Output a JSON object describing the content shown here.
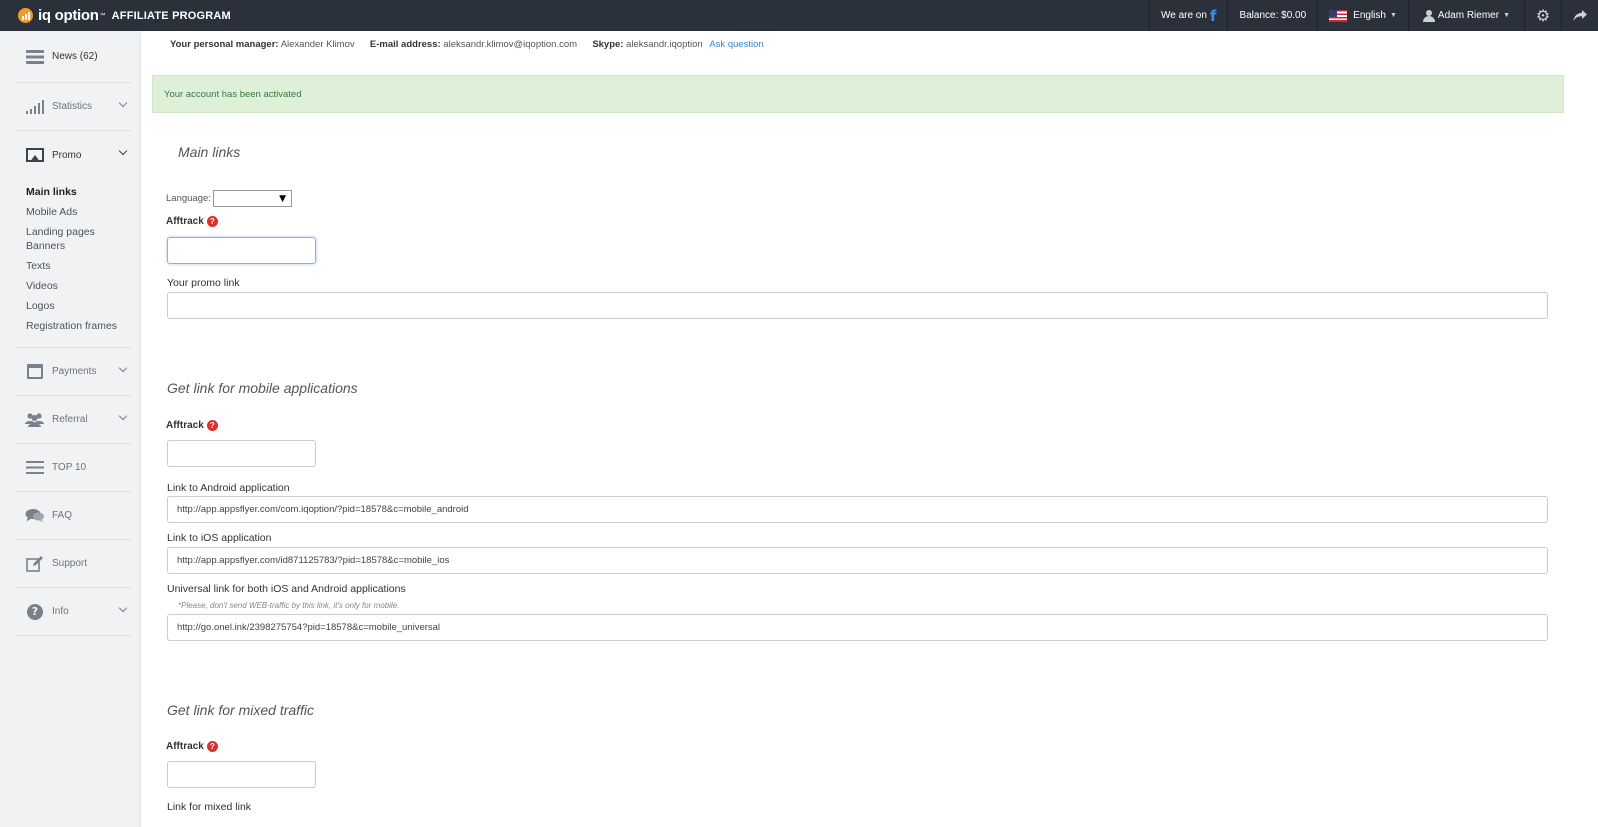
{
  "header": {
    "logo_text": "iq option",
    "logo_tm": "™",
    "logo_subtitle": "AFFILIATE PROGRAM",
    "we_are_on": "We are on",
    "facebook_glyph": "f",
    "balance": "Balance: $0.00",
    "language": "English",
    "user_name": "Adam Riemer"
  },
  "sidebar": {
    "news": "News (62)",
    "statistics": "Statistics",
    "promo": "Promo",
    "promo_items": [
      "Main links",
      "Mobile Ads",
      "Landing pages",
      "Banners",
      "Texts",
      "Videos",
      "Logos",
      "Registration frames"
    ],
    "payments": "Payments",
    "referral": "Referral",
    "top10": "TOP 10",
    "faq": "FAQ",
    "support": "Support",
    "info": "Info"
  },
  "manager": {
    "manager_label": "Your personal manager:",
    "manager_name": "Alexander Klimov",
    "email_label": "E-mail address:",
    "email": "aleksandr.klimov@iqoption.com",
    "skype_label": "Skype:",
    "skype": "aleksandr.iqoption",
    "ask_question": "Ask question"
  },
  "alert": "Your account has been activated",
  "main_links": {
    "title": "Main links",
    "language_label": "Language:",
    "language_value": "",
    "afftrack_label": "Afftrack",
    "afftrack_value": "",
    "promo_link_label": "Your promo link",
    "promo_link_value": ""
  },
  "mobile": {
    "title": "Get link for mobile applications",
    "afftrack_label": "Afftrack",
    "afftrack_value": "",
    "android_label": "Link to Android application",
    "android_value": "http://app.appsflyer.com/com.iqoption/?pid=18578&c=mobile_android",
    "ios_label": "Link to iOS application",
    "ios_value": "http://app.appsflyer.com/id871125783/?pid=18578&c=mobile_ios",
    "universal_label": "Universal link for both iOS and Android applications",
    "universal_note": "*Please, don't send WEB-traffic by this link, it's only for mobile.",
    "universal_value": "http://go.onel.ink/2398275754?pid=18578&c=mobile_universal"
  },
  "mixed": {
    "title": "Get link for mixed traffic",
    "afftrack_label": "Afftrack",
    "afftrack_value": "",
    "mixed_link_label": "Link for mixed link"
  },
  "colors": {
    "topbar": "#2b313b",
    "logo_orange": "#f19a2b",
    "alert_bg": "#dff0d8",
    "alert_text": "#3c763d",
    "link_blue": "#3a86c8",
    "help_red": "#d9302c"
  },
  "icons": {
    "settings": "gear-icon",
    "logout": "share-arrow-icon"
  }
}
